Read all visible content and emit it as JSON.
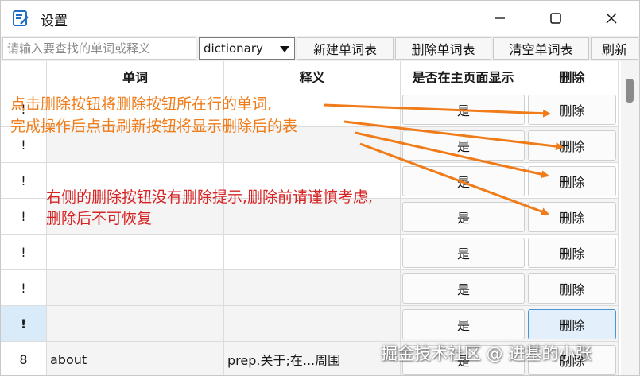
{
  "window": {
    "title": "设置",
    "icon": "notepad-icon",
    "controls": {
      "minimize": "minimize-icon",
      "maximize": "maximize-icon",
      "close": "close-icon"
    }
  },
  "toolbar": {
    "search_placeholder": "请输入要查找的单词或释义",
    "dictionary_selected": "dictionary",
    "new_table_label": "新建单词表",
    "delete_table_label": "删除单词表",
    "clear_table_label": "清空单词表",
    "refresh_label": "刷新"
  },
  "table": {
    "headers": {
      "row_num": "",
      "word": "单词",
      "meaning": "释义",
      "show_on_main": "是否在主页面显示",
      "delete": "删除"
    },
    "rows": [
      {
        "num": "!",
        "word": "",
        "meaning": "",
        "show": "是",
        "delete": "删除"
      },
      {
        "num": "!",
        "word": "",
        "meaning": "",
        "show": "是",
        "delete": "删除"
      },
      {
        "num": "!",
        "word": "",
        "meaning": "",
        "show": "是",
        "delete": "删除"
      },
      {
        "num": "!",
        "word": "",
        "meaning": "",
        "show": "是",
        "delete": "删除"
      },
      {
        "num": "!",
        "word": "",
        "meaning": "",
        "show": "是",
        "delete": "删除"
      },
      {
        "num": "!",
        "word": "",
        "meaning": "",
        "show": "是",
        "delete": "删除"
      },
      {
        "num": "!",
        "word": "",
        "meaning": "",
        "show": "是",
        "delete": "删除"
      },
      {
        "num": "8",
        "word": "about",
        "meaning": "prep.关于;在...周围",
        "show": "是",
        "delete": "删除"
      }
    ],
    "selected_row": 7
  },
  "annotations": {
    "orange_line1": "点击删除按钮将删除按钮所在行的单词,",
    "orange_line2": "完成操作后点击刷新按钮将显示删除后的表",
    "red_line1": "右侧的删除按钮没有删除提示,删除前请谨慎考虑,",
    "red_line2": "删除后不可恢复",
    "orange_color": "#f07c19",
    "red_color": "#d62424"
  },
  "watermark": "掘金技术社区 @ 进基的小张",
  "colors": {
    "selected_row": "#d9ebf9",
    "button_highlight_border": "#4a95d8"
  }
}
